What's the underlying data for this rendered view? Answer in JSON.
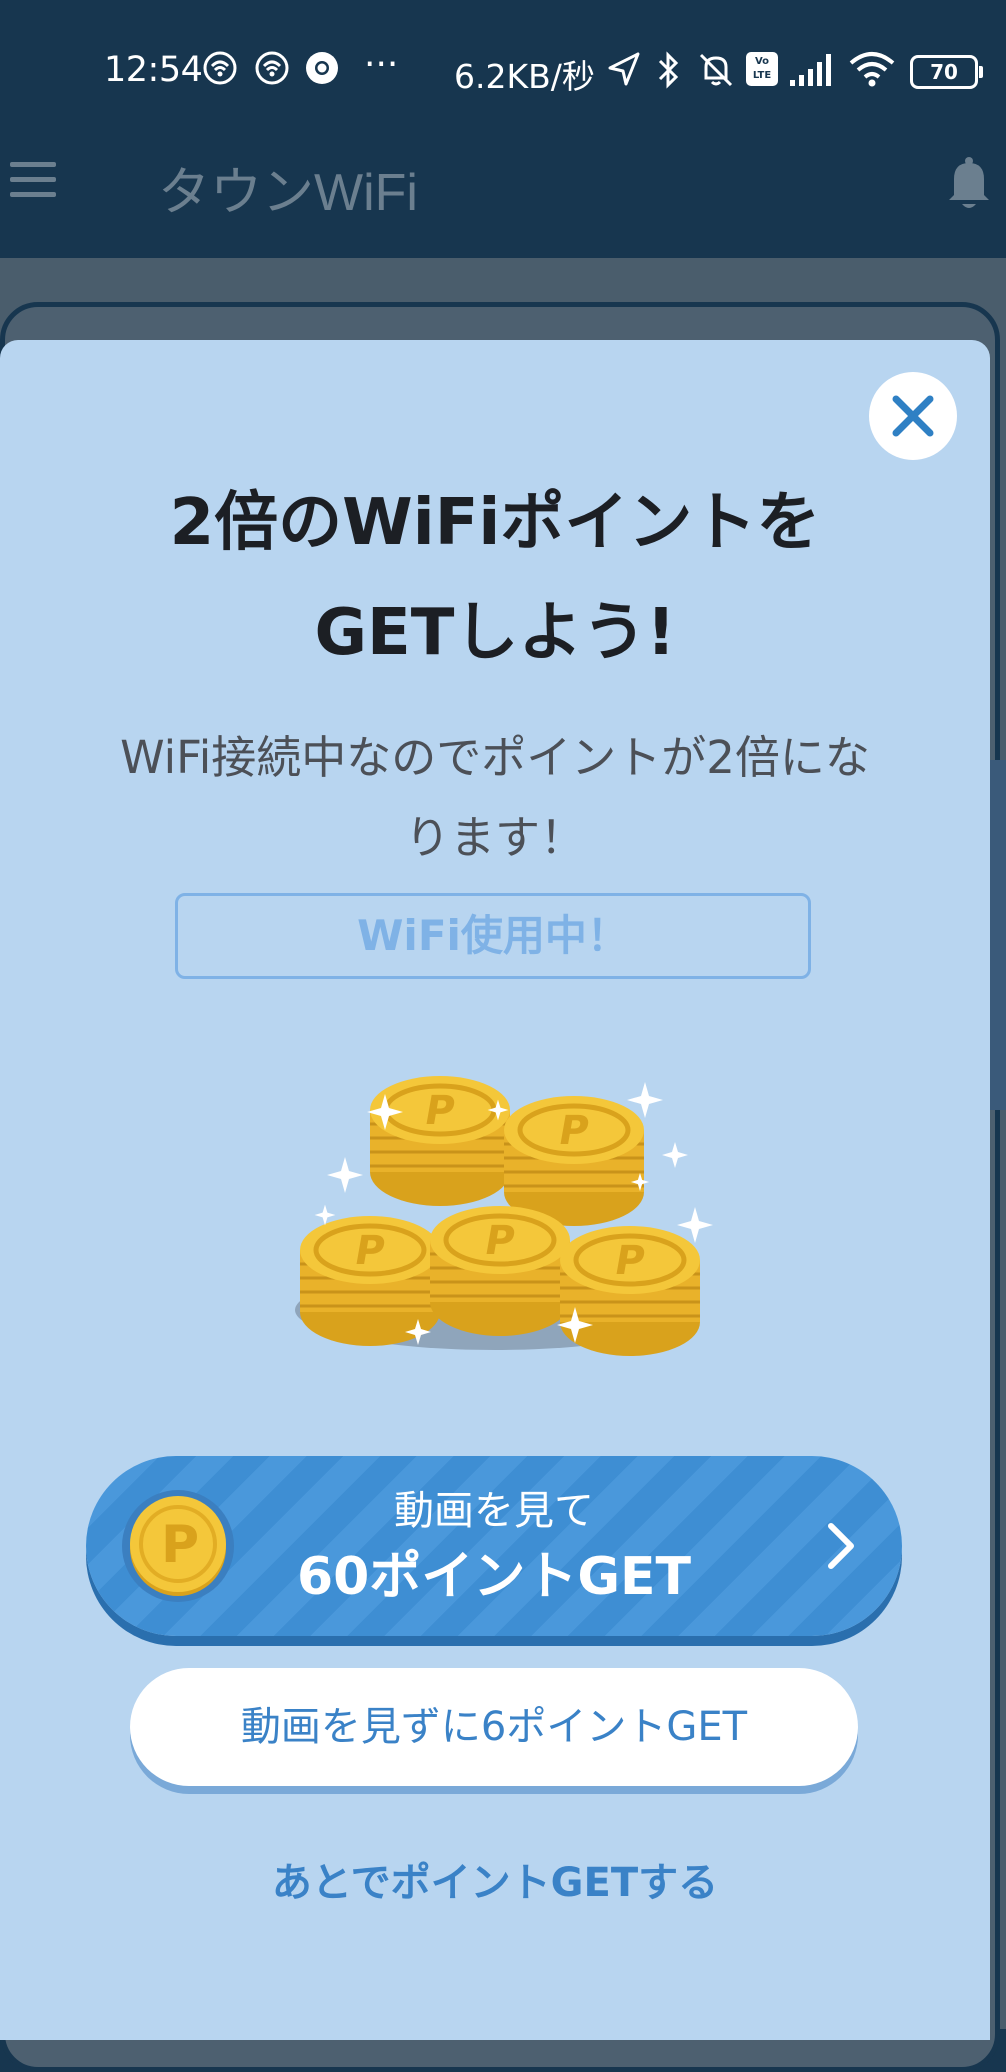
{
  "status_bar": {
    "time": "12:54",
    "more": "···",
    "net_speed": "6.2KB/秒",
    "battery": "70",
    "volte": "Vo LTE"
  },
  "app_bar": {
    "title": "タウンWiFi"
  },
  "modal": {
    "title_line1": "2倍のWiFiポイントを",
    "title_line2": "GETしよう!",
    "subtitle_line1": "WiFi接続中なのでポイントが2倍にな",
    "subtitle_line2": "ります！",
    "status_label": "WiFi使用中！",
    "coin_letter": "P",
    "primary_button": {
      "line1": "動画を見て",
      "line2": "60ポイントGET"
    },
    "secondary_button": "動画を見ずに6ポイントGET",
    "later_link": "あとでポイントGETする"
  },
  "colors": {
    "status_bar_bg": "#17364f",
    "modal_bg": "#b8d5f0",
    "primary": "#3e8ed3",
    "accent_text": "#3a82c7",
    "coin": "#f2c230"
  },
  "icons": [
    "menu-icon",
    "bell-icon",
    "close-icon",
    "coin-icon",
    "chevron-right-icon",
    "wifi-icon",
    "bluetooth-icon",
    "location-icon",
    "mute-icon",
    "signal-icon",
    "chrome-icon"
  ]
}
